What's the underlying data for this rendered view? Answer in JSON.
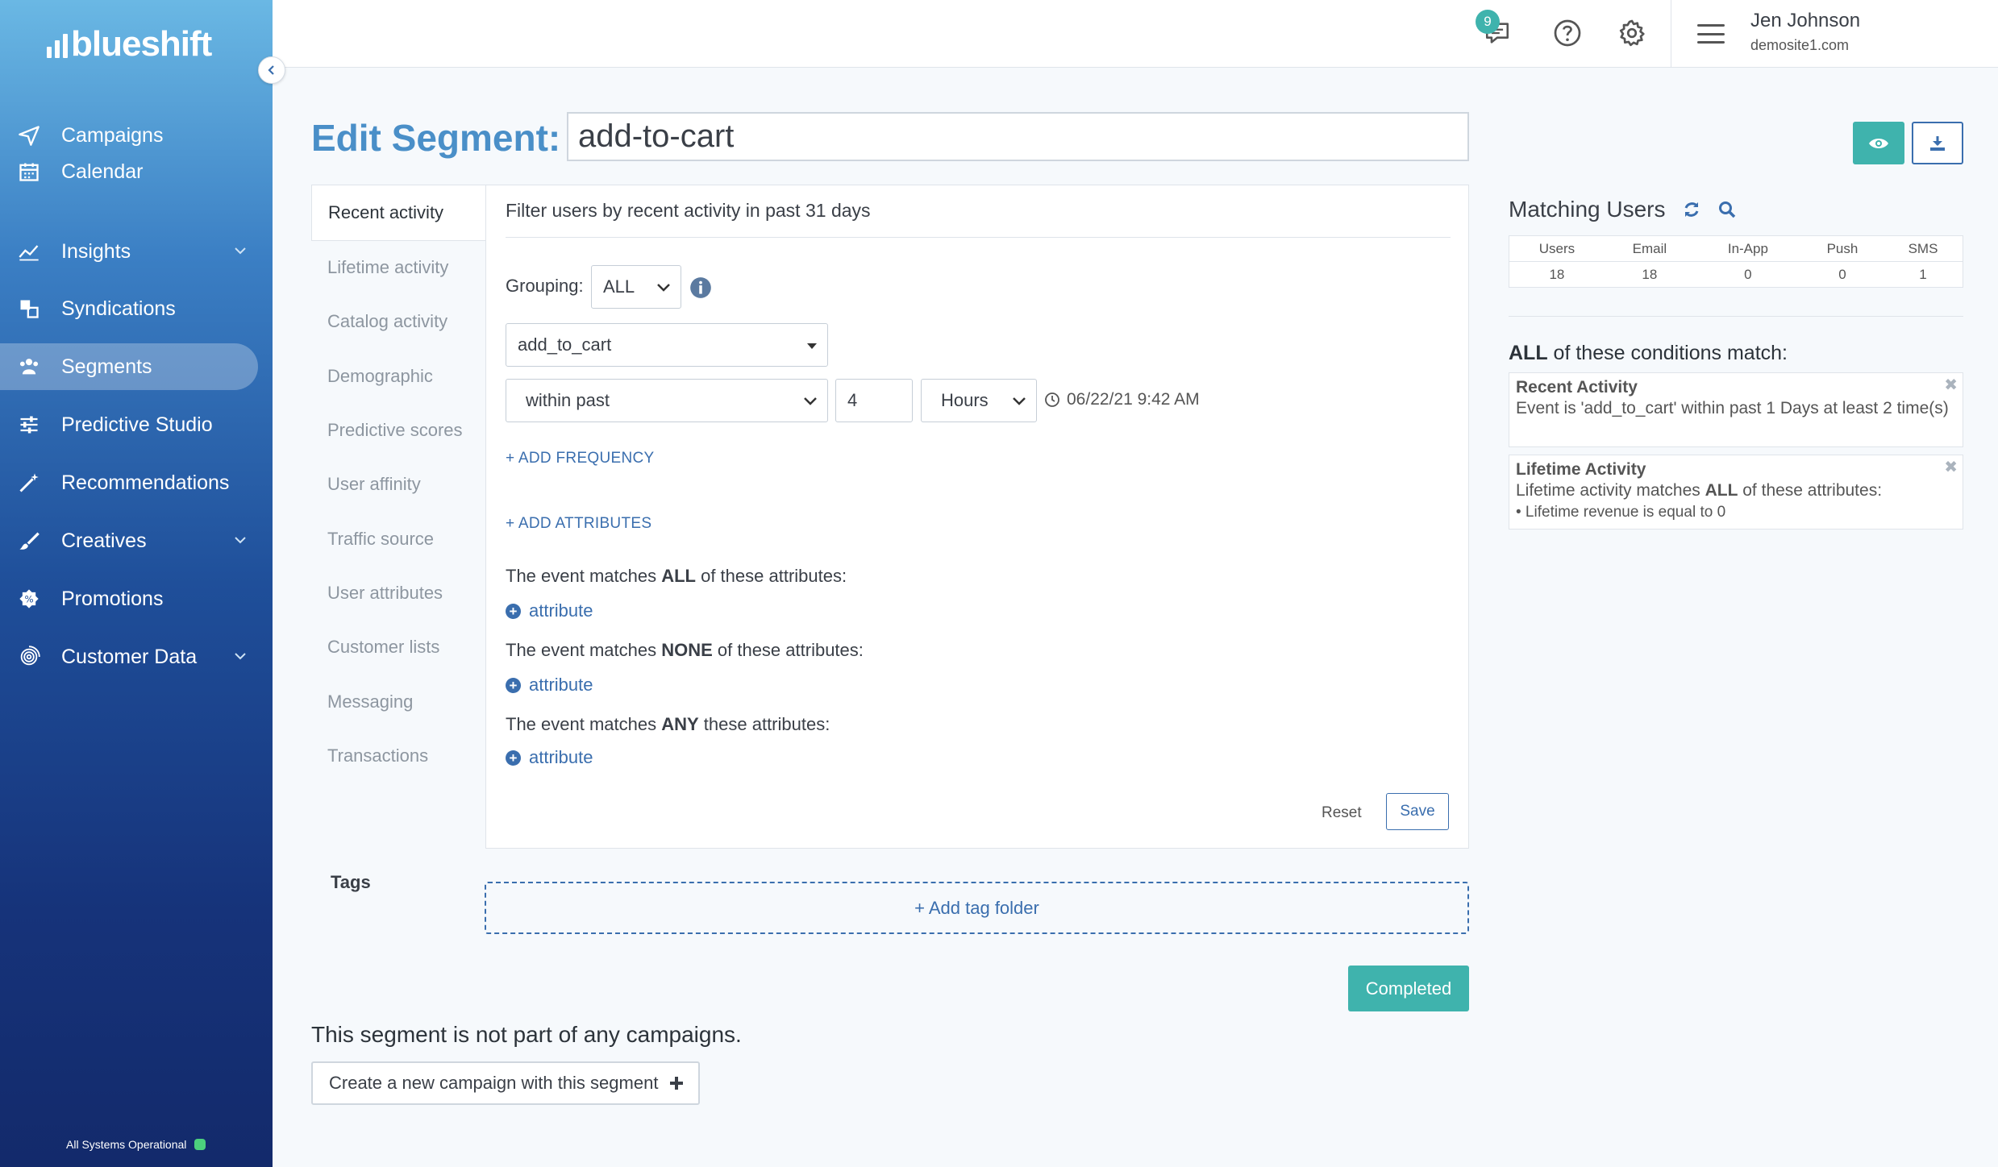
{
  "brand": {
    "logo_text": "blueshift",
    "accent": "#3fb3ad",
    "link": "#3a6eae",
    "title_color": "#4a8fc8"
  },
  "sidebar": {
    "items": [
      {
        "label": "Campaigns",
        "icon": "paper-plane-icon",
        "has_chevron": false,
        "active": false
      },
      {
        "label": "Calendar",
        "icon": "calendar-icon",
        "has_chevron": false,
        "active": false
      },
      {
        "label": "Insights",
        "icon": "line-chart-icon",
        "has_chevron": true,
        "active": false
      },
      {
        "label": "Syndications",
        "icon": "syndication-icon",
        "has_chevron": false,
        "active": false
      },
      {
        "label": "Segments",
        "icon": "users-icon",
        "has_chevron": false,
        "active": true
      },
      {
        "label": "Predictive Studio",
        "icon": "sliders-icon",
        "has_chevron": false,
        "active": false
      },
      {
        "label": "Recommendations",
        "icon": "magic-wand-icon",
        "has_chevron": false,
        "active": false
      },
      {
        "label": "Creatives",
        "icon": "brush-icon",
        "has_chevron": true,
        "active": false
      },
      {
        "label": "Promotions",
        "icon": "badge-icon",
        "has_chevron": false,
        "active": false
      },
      {
        "label": "Customer Data",
        "icon": "fingerprint-icon",
        "has_chevron": true,
        "active": false
      }
    ],
    "status": "All Systems Operational"
  },
  "topbar": {
    "notification_count": "9",
    "user_name": "Jen Johnson",
    "user_site": "demosite1.com"
  },
  "header": {
    "title": "Edit Segment:",
    "segment_name": "add-to-cart"
  },
  "tabs": [
    {
      "label": "Recent activity",
      "active": true
    },
    {
      "label": "Lifetime activity",
      "active": false
    },
    {
      "label": "Catalog activity",
      "active": false
    },
    {
      "label": "Demographic",
      "active": false
    },
    {
      "label": "Predictive scores",
      "active": false
    },
    {
      "label": "User affinity",
      "active": false
    },
    {
      "label": "Traffic source",
      "active": false
    },
    {
      "label": "User attributes",
      "active": false
    },
    {
      "label": "Customer lists",
      "active": false
    },
    {
      "label": "Messaging",
      "active": false
    },
    {
      "label": "Transactions",
      "active": false
    }
  ],
  "filter": {
    "description": "Filter users by recent activity in past 31 days",
    "grouping_label": "Grouping:",
    "grouping_value": "ALL",
    "event_value": "add_to_cart",
    "time_op": "within past",
    "time_amount": "4",
    "time_unit": "Hours",
    "timestamp": "06/22/21 9:42 AM",
    "add_frequency": "+ ADD FREQUENCY",
    "add_attributes": "+ ADD ATTRIBUTES",
    "match_all": {
      "pre": "The event matches ",
      "kw": "ALL",
      "post": " of these attributes:"
    },
    "match_none": {
      "pre": "The event matches ",
      "kw": "NONE",
      "post": " of these attributes:"
    },
    "match_any": {
      "pre": "The event matches ",
      "kw": "ANY",
      "post": " these attributes:"
    },
    "attribute_link": "attribute",
    "reset": "Reset",
    "save": "Save"
  },
  "tags": {
    "label": "Tags",
    "add_folder": "+ Add tag folder"
  },
  "completed": "Completed",
  "campaign_note": "This segment is not part of any campaigns.",
  "create_campaign": "Create a new campaign with this segment",
  "matching_users": {
    "title": "Matching Users",
    "headers": [
      "Users",
      "Email",
      "In-App",
      "Push",
      "SMS"
    ],
    "values": [
      "18",
      "18",
      "0",
      "0",
      "1"
    ]
  },
  "conditions": {
    "title_kw": "ALL",
    "title_rest": " of these conditions match:",
    "items": [
      {
        "title": "Recent Activity",
        "desc": "Event is 'add_to_cart' within past 1 Days at least 2 time(s)"
      },
      {
        "title": "Lifetime Activity",
        "desc_pre": "Lifetime activity matches ",
        "desc_kw": "ALL",
        "desc_post": " of these attributes:",
        "bullet": "• Lifetime revenue is equal to 0"
      }
    ]
  }
}
